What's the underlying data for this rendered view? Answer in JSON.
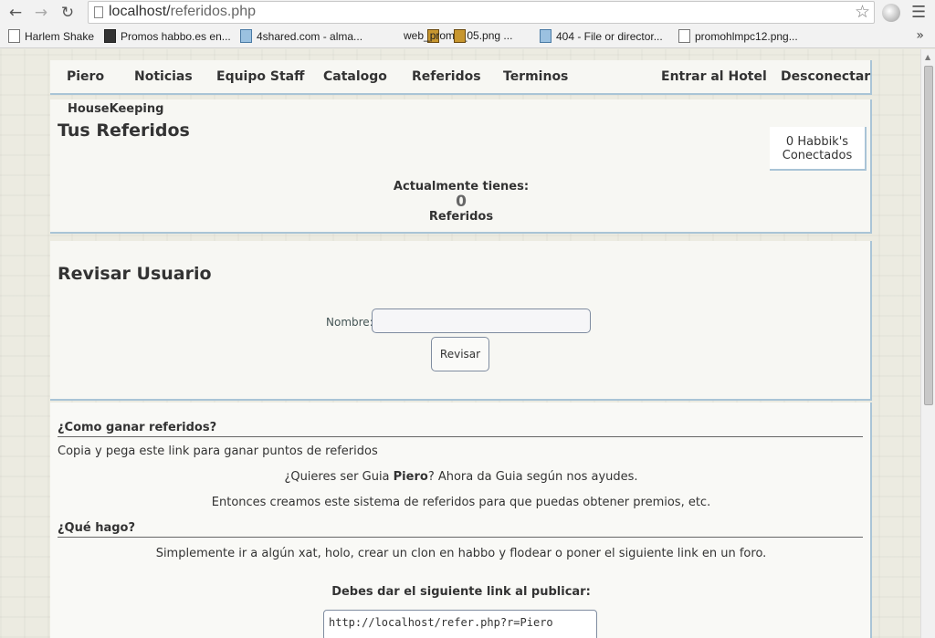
{
  "browser": {
    "url_host": "localhost/",
    "url_path": "referidos.php",
    "bookmarks": [
      "Harlem Shake",
      "Promos habbo.es en...",
      "4shared.com - alma...",
      "web_promo_05.png ...",
      "404 - File or director...",
      "promohlmpc12.png..."
    ],
    "more": "»"
  },
  "nav": {
    "items": [
      "Piero",
      "Noticias",
      "Equipo Staff",
      "Catalogo",
      "Referidos",
      "Terminos"
    ],
    "right": [
      "Entrar al Hotel",
      "Desconectar"
    ]
  },
  "referidos": {
    "housekeeping": "HouseKeeping",
    "title": "Tus Referidos",
    "online_line1": "0 Habbik's",
    "online_line2": "Conectados",
    "count_label": "Actualmente tienes:",
    "count": "0",
    "count_unit": "Referidos"
  },
  "revisar": {
    "title": "Revisar Usuario",
    "name_label": "Nombre:",
    "name_value": "",
    "button": "Revisar"
  },
  "info": {
    "h1": "¿Como ganar referidos?",
    "p1": "Copia y pega este link para ganar puntos de referidos",
    "p2_pre": "¿Quieres ser Guia ",
    "p2_name": "Piero",
    "p2_post": "? Ahora da Guia según nos ayudes.",
    "p3": "Entonces creamos este sistema de referidos para que puedas obtener premios, etc.",
    "h2": "¿Qué hago?",
    "p4": "Simplemente ir a algún xat, holo, crear un clon en habbo y flodear o poner el siguiente link en un foro.",
    "p5": "Debes dar el siguiente link al publicar:",
    "link": "http://localhost/refer.php?r=Piero"
  }
}
